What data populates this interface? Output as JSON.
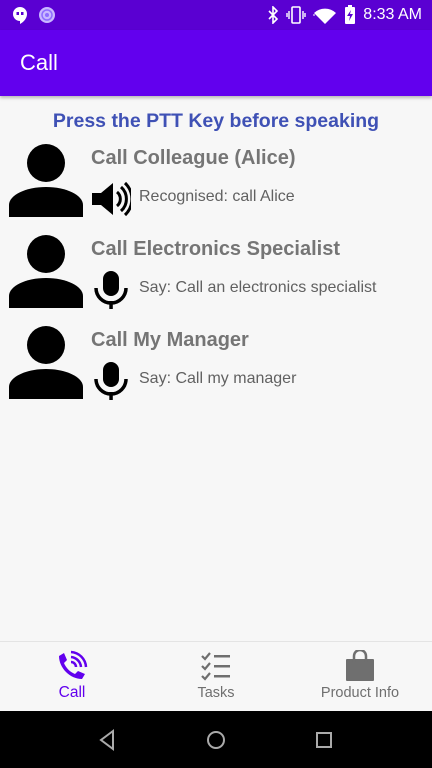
{
  "status_bar": {
    "time": "8:33 AM",
    "left_icons": [
      "hangouts-icon",
      "app-notification-icon"
    ],
    "right_icons": [
      "bluetooth-icon",
      "vibrate-icon",
      "wifi-icon",
      "battery-charging-icon"
    ]
  },
  "app_bar": {
    "title": "Call"
  },
  "main": {
    "instruction": "Press the PTT Key before speaking",
    "calls": [
      {
        "title": "Call Colleague (Alice)",
        "icon": "speaker-icon",
        "status": "Recognised: call Alice"
      },
      {
        "title": "Call Electronics Specialist",
        "icon": "microphone-icon",
        "status": "Say: Call an electronics specialist"
      },
      {
        "title": "Call My Manager",
        "icon": "microphone-icon",
        "status": "Say: Call my manager"
      }
    ]
  },
  "bottom_nav": {
    "items": [
      {
        "label": "Call",
        "icon": "phone-wifi-icon",
        "active": true
      },
      {
        "label": "Tasks",
        "icon": "task-list-icon",
        "active": false
      },
      {
        "label": "Product Info",
        "icon": "shopping-bag-icon",
        "active": false
      }
    ]
  },
  "colors": {
    "status_bar": "#5a00d2",
    "app_bar": "#6200ee",
    "instruction": "#3f51b5",
    "active_nav": "#6200ee"
  }
}
